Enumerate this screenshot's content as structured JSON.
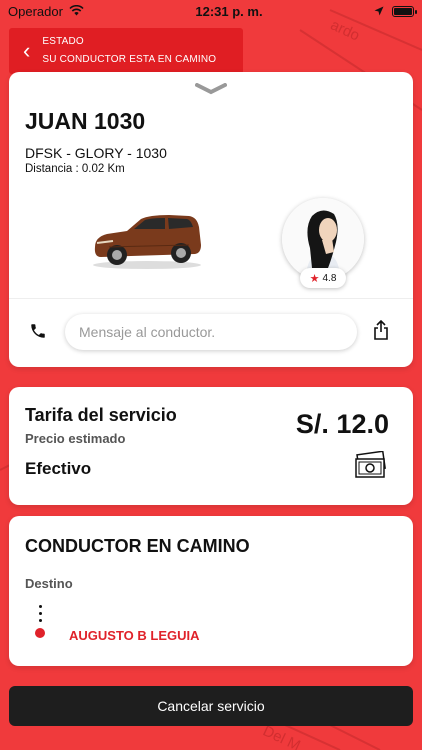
{
  "status_bar": {
    "carrier": "Operador",
    "time": "12:31 p. m."
  },
  "header": {
    "label": "ESTADO",
    "status": "SU CONDUCTOR ESTA EN CAMINO"
  },
  "map": {
    "labels": [
      "ardo",
      "Del M"
    ]
  },
  "driver": {
    "plate": "JUAN 1030",
    "car_model": "DFSK - GLORY - 1030",
    "distance": "Distancia : 0.02 Km",
    "rating": "4.8"
  },
  "message": {
    "placeholder": "Mensaje al conductor."
  },
  "fare": {
    "title": "Tarifa del servicio",
    "subtitle": "Precio estimado",
    "price": "S/. 12.0",
    "payment_method": "Efectivo"
  },
  "route": {
    "title": "CONDUCTOR EN CAMINO",
    "destination_label": "Destino",
    "destination": "AUGUSTO B LEGUIA"
  },
  "actions": {
    "cancel_label": "Cancelar servicio"
  },
  "colors": {
    "accent": "#e0222a",
    "background": "#f03a3c",
    "button": "#1e1e1e"
  }
}
